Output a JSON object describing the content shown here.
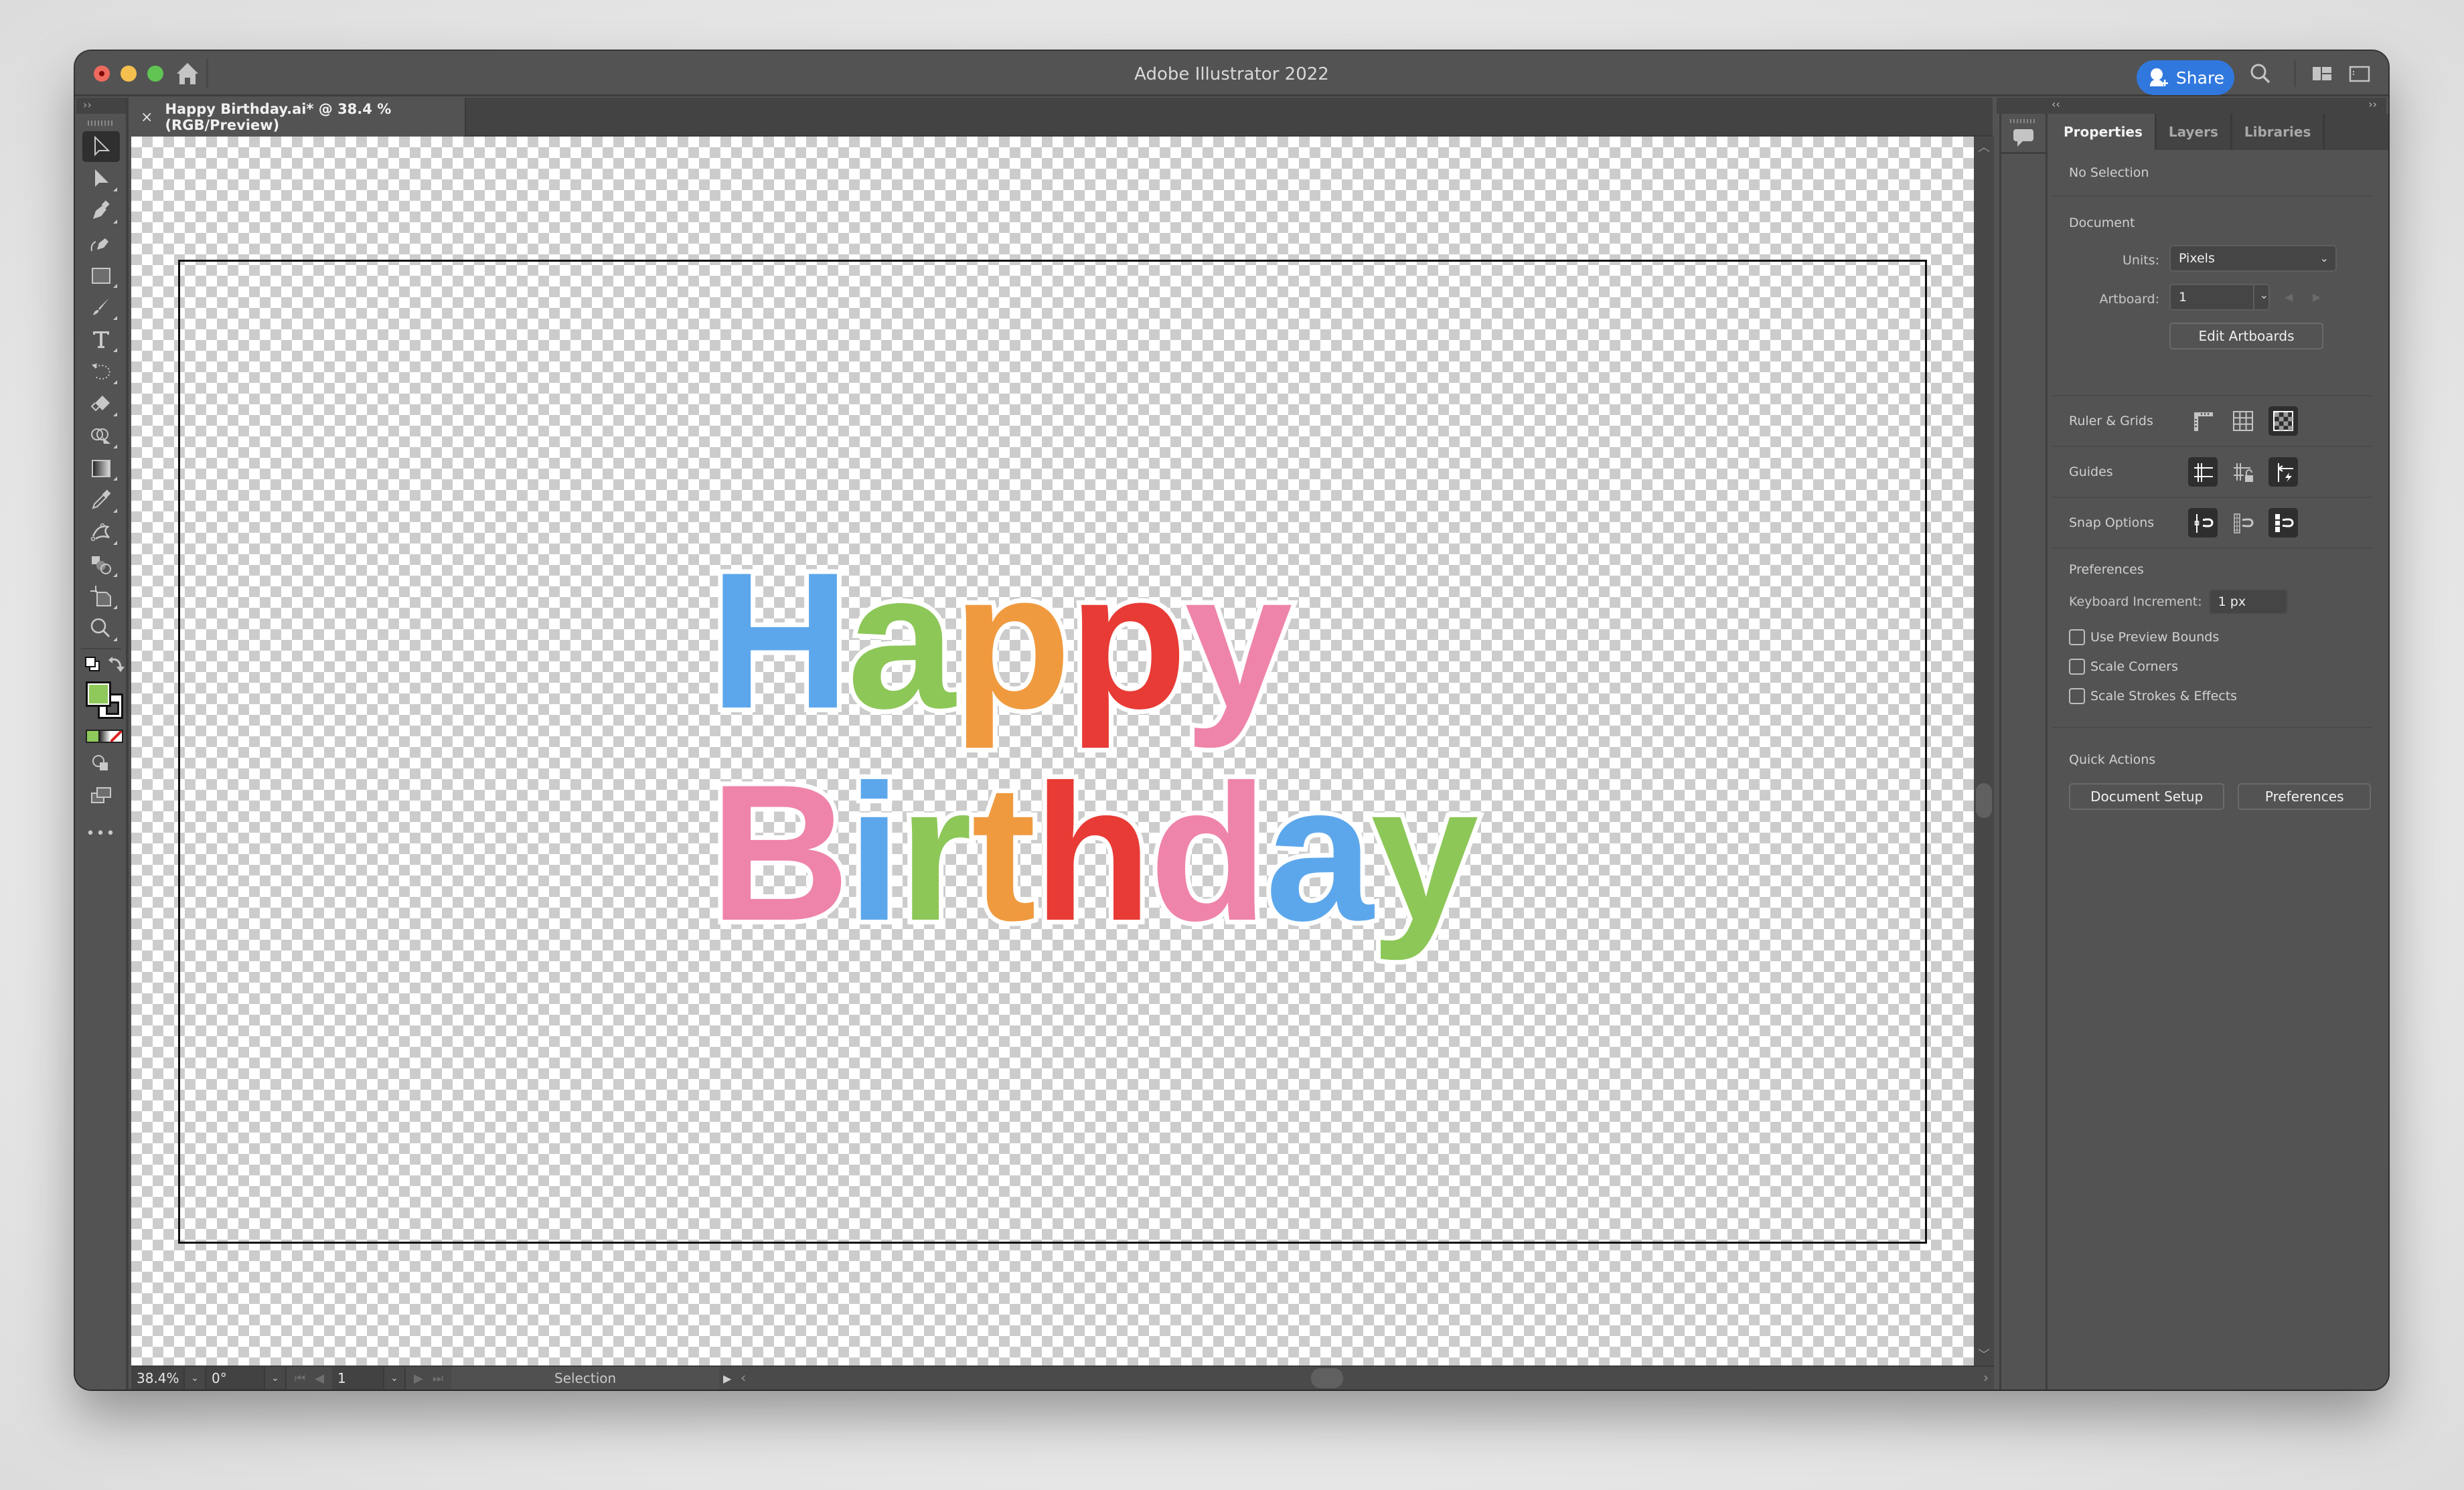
{
  "app": {
    "title": "Adobe Illustrator 2022",
    "share_label": "Share"
  },
  "document_tab": {
    "close_glyph": "×",
    "title": "Happy Birthday.ai* @ 38.4 % (RGB/Preview)"
  },
  "toolbar": {
    "collapse_glyph": "››",
    "tools": [
      {
        "name": "selection-tool",
        "active": true
      },
      {
        "name": "direct-selection-tool"
      },
      {
        "name": "pen-tool"
      },
      {
        "name": "curvature-tool"
      },
      {
        "name": "rectangle-tool"
      },
      {
        "name": "paintbrush-tool"
      },
      {
        "name": "type-tool"
      },
      {
        "name": "rotate-tool"
      },
      {
        "name": "eraser-tool"
      },
      {
        "name": "shape-builder-tool"
      },
      {
        "name": "gradient-tool"
      },
      {
        "name": "eyedropper-tool"
      },
      {
        "name": "puppet-warp-tool"
      },
      {
        "name": "blend-tool"
      },
      {
        "name": "artboard-tool"
      },
      {
        "name": "zoom-tool"
      }
    ],
    "fill_color": "#8fc95b",
    "stroke_color": "#ffffff",
    "more_glyph": "•••"
  },
  "artwork": {
    "line1": [
      {
        "char": "H",
        "color": "#5ca7ec"
      },
      {
        "char": "a",
        "color": "#8dc758"
      },
      {
        "char": "p",
        "color": "#f09a40"
      },
      {
        "char": "p",
        "color": "#e83b35"
      },
      {
        "char": "y",
        "color": "#ef84ab"
      }
    ],
    "line2": [
      {
        "char": "B",
        "color": "#ef84ab"
      },
      {
        "char": "i",
        "color": "#5ca7ec"
      },
      {
        "char": "r",
        "color": "#8dc758"
      },
      {
        "char": "t",
        "color": "#f09a40"
      },
      {
        "char": "h",
        "color": "#e83b35"
      },
      {
        "char": "d",
        "color": "#ef84ab"
      },
      {
        "char": "a",
        "color": "#5ca7ec"
      },
      {
        "char": "y",
        "color": "#8dc758"
      }
    ],
    "outline_color": "#ffffff"
  },
  "statusbar": {
    "zoom": "38.4%",
    "rotation": "0°",
    "artboard_number": "1",
    "current_tool": "Selection"
  },
  "properties_panel": {
    "tabs": [
      {
        "label": "Properties",
        "active": true
      },
      {
        "label": "Layers",
        "active": false
      },
      {
        "label": "Libraries",
        "active": false
      }
    ],
    "selection_status": "No Selection",
    "document": {
      "heading": "Document",
      "units_label": "Units:",
      "units_value": "Pixels",
      "artboard_label": "Artboard:",
      "artboard_value": "1",
      "edit_artboards_label": "Edit Artboards"
    },
    "ruler_grids": {
      "label": "Ruler & Grids",
      "buttons": [
        {
          "icon": "ruler-icon",
          "on": false
        },
        {
          "icon": "grid-icon",
          "on": false
        },
        {
          "icon": "transparency-grid-icon",
          "on": true
        }
      ]
    },
    "guides": {
      "label": "Guides",
      "buttons": [
        {
          "icon": "show-guides-icon",
          "on": true
        },
        {
          "icon": "lock-guides-icon",
          "on": false
        },
        {
          "icon": "smart-guides-icon",
          "on": true
        }
      ]
    },
    "snap_options": {
      "label": "Snap Options",
      "buttons": [
        {
          "icon": "snap-to-point-icon",
          "on": true
        },
        {
          "icon": "snap-to-pixel-icon",
          "on": false
        },
        {
          "icon": "snap-to-glyph-icon",
          "on": true
        }
      ]
    },
    "preferences": {
      "heading": "Preferences",
      "keyboard_increment_label": "Keyboard Increment:",
      "keyboard_increment_value": "1 px",
      "checkboxes": [
        {
          "label": "Use Preview Bounds",
          "checked": false
        },
        {
          "label": "Scale Corners",
          "checked": false
        },
        {
          "label": "Scale Strokes & Effects",
          "checked": false
        }
      ]
    },
    "quick_actions": {
      "heading": "Quick Actions",
      "document_setup_label": "Document Setup",
      "preferences_label": "Preferences"
    }
  },
  "colors": {
    "share_blue": "#3178de",
    "chrome_gray": "#535353",
    "chrome_dark": "#434343"
  }
}
